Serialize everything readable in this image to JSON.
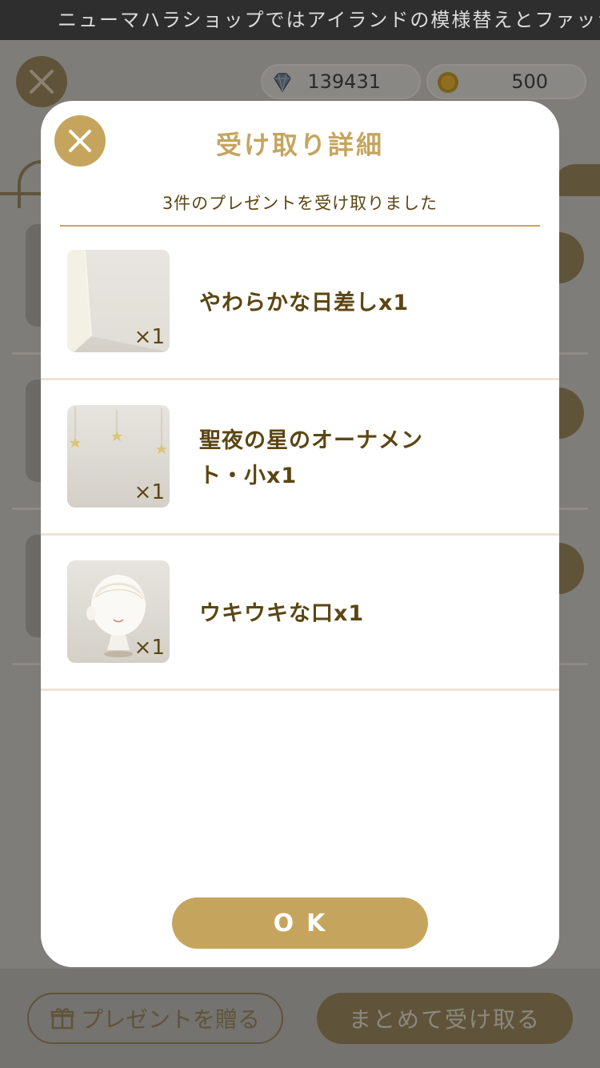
{
  "ticker": {
    "text": "ニューマハラショップではアイランドの模様替えとファッショ"
  },
  "currency": {
    "gems": {
      "icon": "diamond-icon",
      "value": "139431"
    },
    "coins": {
      "icon": "coin-icon",
      "value": "500"
    }
  },
  "footer": {
    "gift_label": "プレゼントを贈る",
    "receive_all_label": "まとめて受け取る"
  },
  "modal": {
    "title": "受け取り詳細",
    "subtitle": "3件のプレゼントを受け取りました",
    "items": [
      {
        "name": "やわらかな日差しx1",
        "qty": "×1",
        "icon": "sunlight-item-icon"
      },
      {
        "name": "聖夜の星のオーナメント・小x1",
        "qty": "×1",
        "icon": "star-ornament-item-icon"
      },
      {
        "name": "ウキウキな口x1",
        "qty": "×1",
        "icon": "avatar-mouth-item-icon"
      }
    ],
    "ok_label": "OK"
  },
  "colors": {
    "accent": "#c5a55e",
    "text_brown": "#5b4613",
    "divider": "#ede4d2",
    "overlay": "#7f7d79"
  }
}
